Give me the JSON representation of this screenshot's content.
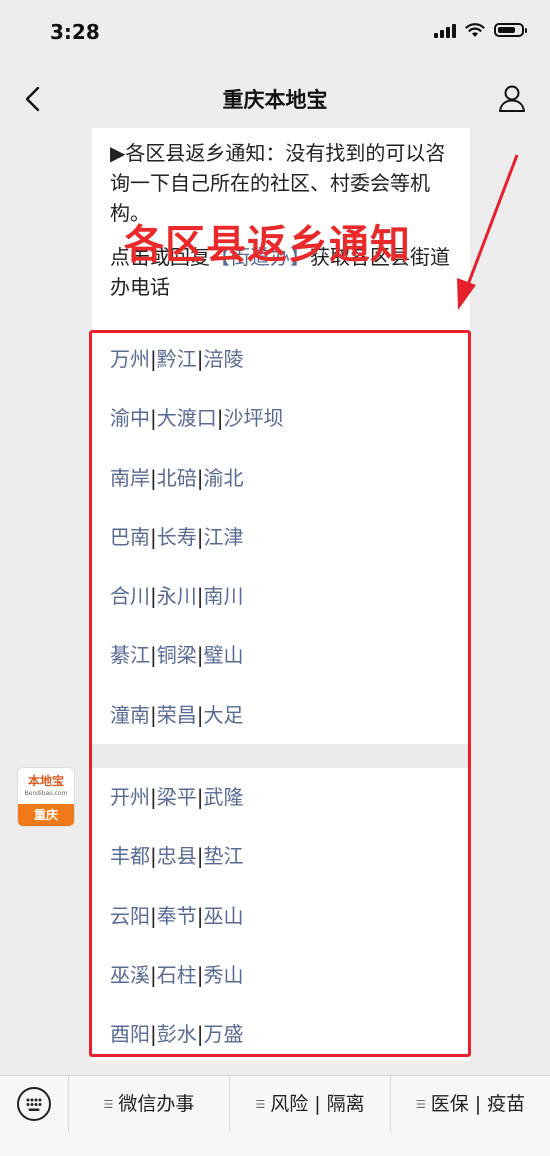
{
  "status_bar": {
    "time": "3:28"
  },
  "nav": {
    "title": "重庆本地宝"
  },
  "notice": {
    "line1": "▶各区县返乡通知：没有找到的可以咨询一下自己所在的社区、村委会等机构。",
    "action_prefix": "点击或回复",
    "action_link": "【街道办】",
    "action_suffix": "获取各区县街道办电话"
  },
  "overlay_title": "各区县返乡通知",
  "district_groups": [
    [
      [
        "万州",
        "黔江",
        "涪陵"
      ],
      [
        "渝中",
        "大渡口",
        "沙坪坝"
      ],
      [
        "南岸",
        "北碚",
        "渝北"
      ],
      [
        "巴南",
        "长寿",
        "江津"
      ],
      [
        "合川",
        "永川",
        "南川"
      ],
      [
        "綦江",
        "铜梁",
        "璧山"
      ],
      [
        "潼南",
        "荣昌",
        "大足"
      ]
    ],
    [
      [
        "开州",
        "梁平",
        "武隆"
      ],
      [
        "丰都",
        "忠县",
        "垫江"
      ],
      [
        "云阳",
        "奉节",
        "巫山"
      ],
      [
        "巫溪",
        "石柱",
        "秀山"
      ],
      [
        "酉阳",
        "彭水",
        "万盛"
      ]
    ]
  ],
  "account_logo": {
    "brand": "本地宝",
    "domain": "Bendibao.com",
    "city": "重庆"
  },
  "bottom_menu": [
    "微信办事",
    "风险 | 隔离",
    "医保 | 疫苗"
  ],
  "colors": {
    "link": "#576b95",
    "annotation_red": "#e8202b",
    "brand_orange": "#f07a1a"
  },
  "icons": [
    "back-arrow-icon",
    "profile-icon",
    "signal-icon",
    "wifi-icon",
    "battery-icon",
    "keyboard-icon",
    "menu-hamburger-icon"
  ]
}
